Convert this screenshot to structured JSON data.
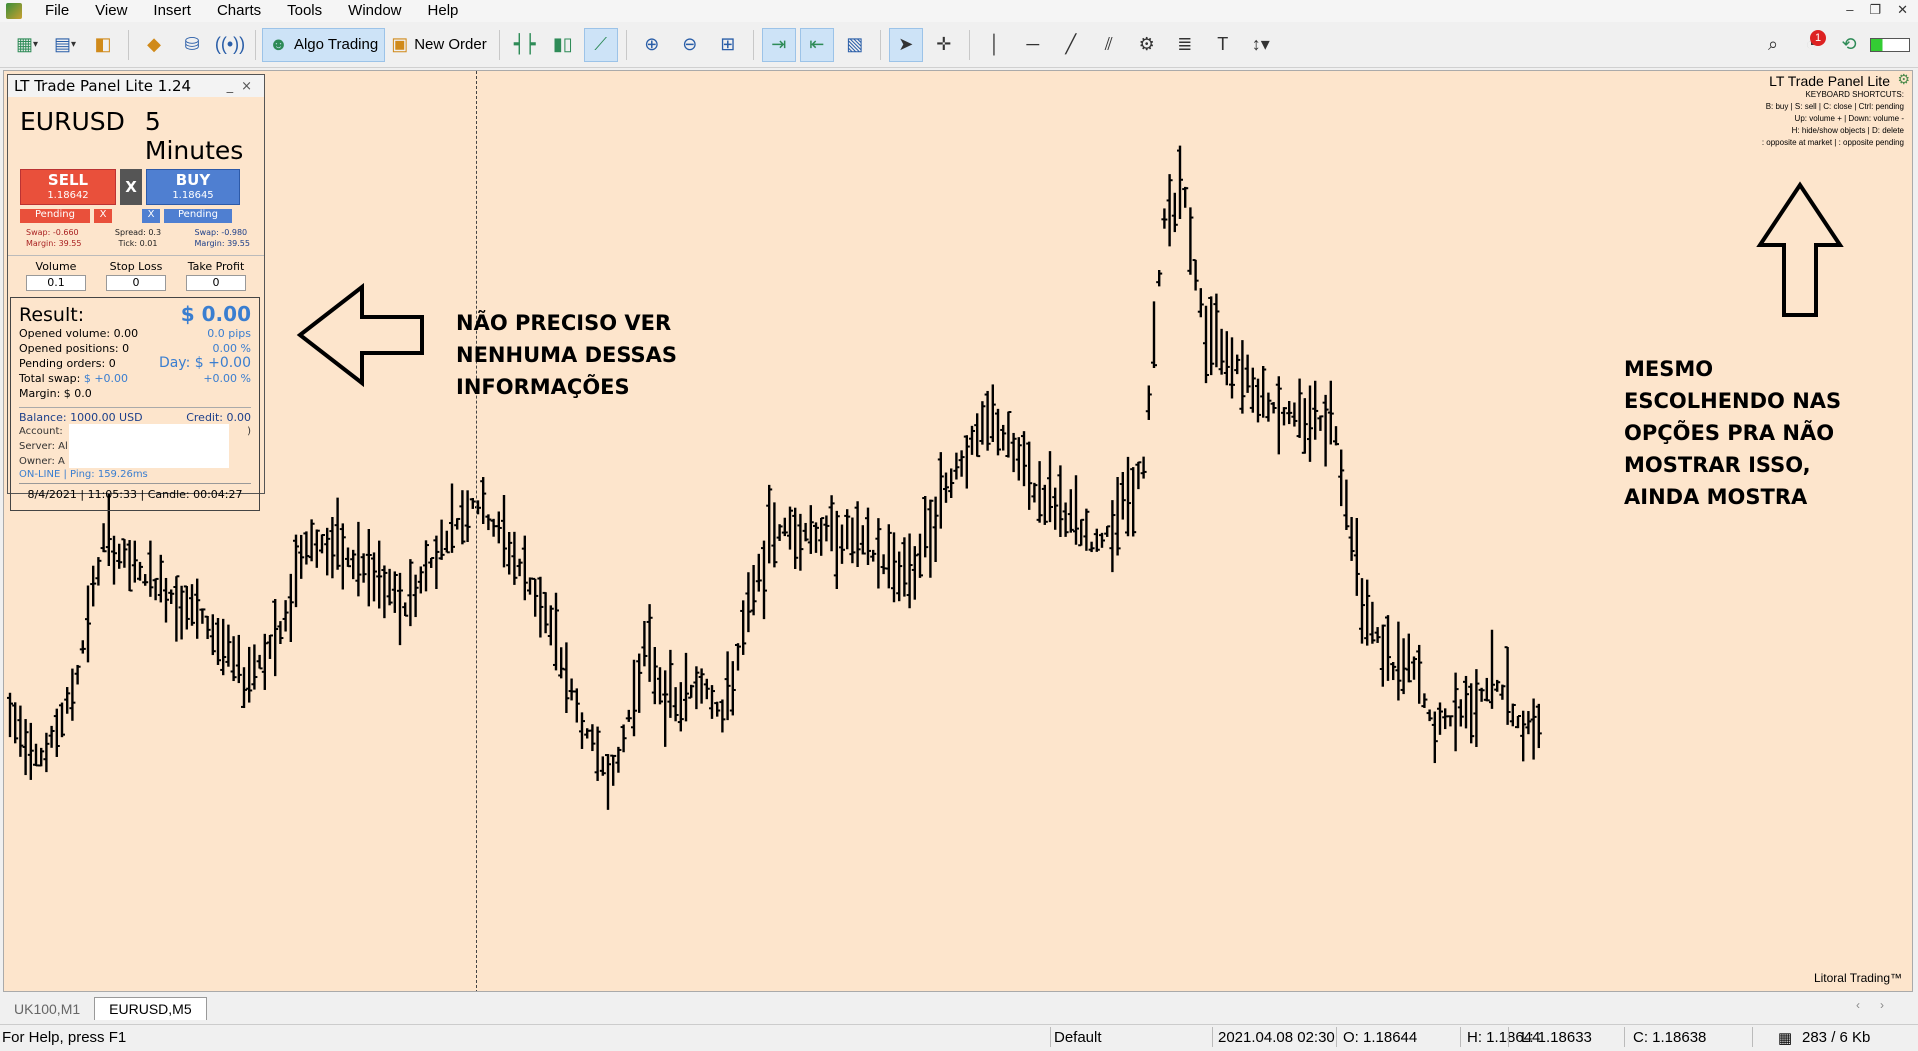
{
  "menu": [
    "File",
    "View",
    "Insert",
    "Charts",
    "Tools",
    "Window",
    "Help"
  ],
  "window_controls": [
    "–",
    "❐",
    "✕"
  ],
  "toolbar": {
    "algo_trading": "Algo Trading",
    "new_order": "New Order"
  },
  "panel": {
    "title": "LT Trade Panel Lite 1.24",
    "symbol": "EURUSD",
    "timeframe": "5 Minutes",
    "sell_label": "SELL",
    "sell_price": "1.18642",
    "buy_label": "BUY",
    "buy_price": "1.18645",
    "close_x": "X",
    "pending_sell": "Pending",
    "pending_buy": "Pending",
    "swap_sell": "Swap: -0.660",
    "margin_sell": "Margin: 39.55",
    "spread": "Spread: 0.3",
    "tick": "Tick: 0.01",
    "swap_buy": "Swap: -0.980",
    "margin_buy": "Margin: 39.55",
    "volume_label": "Volume",
    "stoploss_label": "Stop Loss",
    "takeprofit_label": "Take Profit",
    "volume_value": "0.1",
    "stoploss_value": "0",
    "takeprofit_value": "0",
    "result_label": "Result:",
    "result_value": "$ 0.00",
    "result_pips": "0.0 pips",
    "result_pct": "0.00 %",
    "opened_volume": "Opened volume: 0.00",
    "opened_positions": "Opened positions: 0",
    "pending_orders": "Pending orders: 0",
    "total_swap_label": "Total swap:",
    "total_swap_value": "$ +0.00",
    "margin": "Margin: $ 0.0",
    "day_value": "Day: $ +0.00",
    "day_pct": "+0.00 %",
    "balance": "Balance: 1000.00 USD",
    "credit": "Credit: 0.00",
    "account": "Account:",
    "account_tail": ")",
    "server": "Server: Al",
    "owner": "Owner: A",
    "online": "ON-LINE | Ping: 159.26ms",
    "footer": "8/4/2021 | 11:05:33 | Candle: 00:04:27"
  },
  "annotations": {
    "left_note": [
      "NÃO PRECISO VER",
      "NENHUMA DESSAS",
      "INFORMAÇÕES"
    ],
    "right_note": [
      "MESMO",
      "ESCOLHENDO NAS",
      "OPÇÕES PRA NÃO",
      "MOSTRAR ISSO,",
      "AINDA MOSTRA"
    ]
  },
  "shortcuts": {
    "title": "LT Trade Panel Lite",
    "line1": "KEYBOARD SHORTCUTS:",
    "line2": "B: buy | S: sell | C: close | Ctrl: pending",
    "line3": "Up: volume + | Down: volume -",
    "line4": "H: hide/show objects | D: delete",
    "line5": ": opposite at market | : opposite pending"
  },
  "brand": "Litoral Trading™",
  "tabs": [
    "UK100,M1",
    "EURUSD,M5"
  ],
  "active_tab": "EURUSD,M5",
  "status": {
    "help": "For Help, press F1",
    "profile": "Default",
    "datetime": "2021.04.08 02:30",
    "open": "O: 1.18644",
    "high": "H: 1.18644",
    "low": "L: 1.18633",
    "close": "C: 1.18638",
    "traffic": "283 / 6 Kb"
  },
  "notification_count": "1",
  "colors": {
    "chart_bg": "#fde5cc",
    "sell": "#e9503b",
    "buy": "#4f7fd1",
    "accent": "#3a7ed0"
  }
}
